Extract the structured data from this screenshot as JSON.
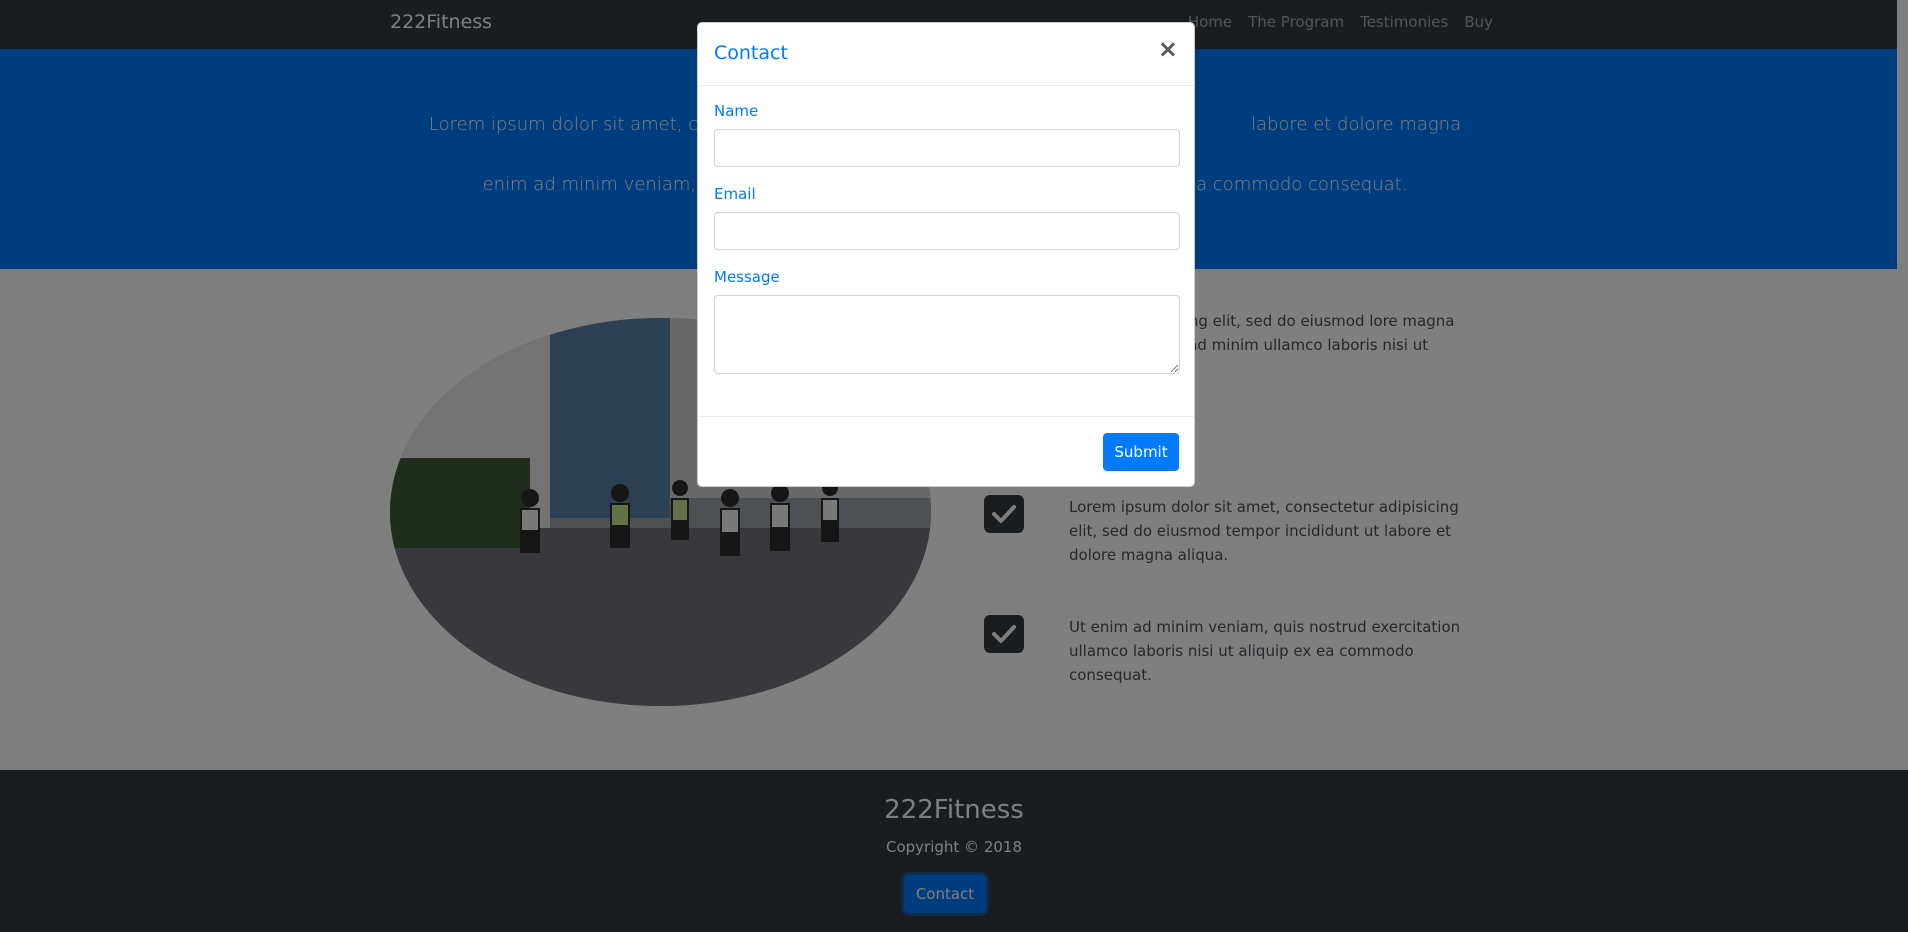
{
  "navbar": {
    "brand": "222Fitness",
    "links": [
      "Home",
      "The Program",
      "Testimonies",
      "Buy"
    ]
  },
  "hero": {
    "text_left": "Lorem ipsum dolor sit amet, consec",
    "text_right": "labore et dolore magna aliqua. Ut",
    "text_line2_left": "enim ad minim veniam,",
    "text_line2_right": "a commodo consequat."
  },
  "features": [
    {
      "text": "ectetur adipisicing elit, sed do eiusmod lore magna aliqua. Ut enim ad minim ullamco laboris nisi ut aliquip ex ea"
    },
    {
      "text": "Lorem ipsum dolor sit amet, consectetur adipisicing elit, sed do eiusmod tempor incididunt ut labore et dolore magna aliqua."
    },
    {
      "text": "Ut enim ad minim veniam, quis nostrud exercitation ullamco laboris nisi ut aliquip ex ea commodo consequat."
    }
  ],
  "footer": {
    "brand": "222Fitness",
    "copyright": "Copyright © 2018",
    "contact_label": "Contact"
  },
  "modal": {
    "title": "Contact",
    "close_glyph": "×",
    "name_label": "Name",
    "email_label": "Email",
    "message_label": "Message",
    "name_value": "",
    "email_value": "",
    "message_value": "",
    "submit_label": "Submit"
  },
  "colors": {
    "accent": "#007bff",
    "dark": "#343a40"
  }
}
